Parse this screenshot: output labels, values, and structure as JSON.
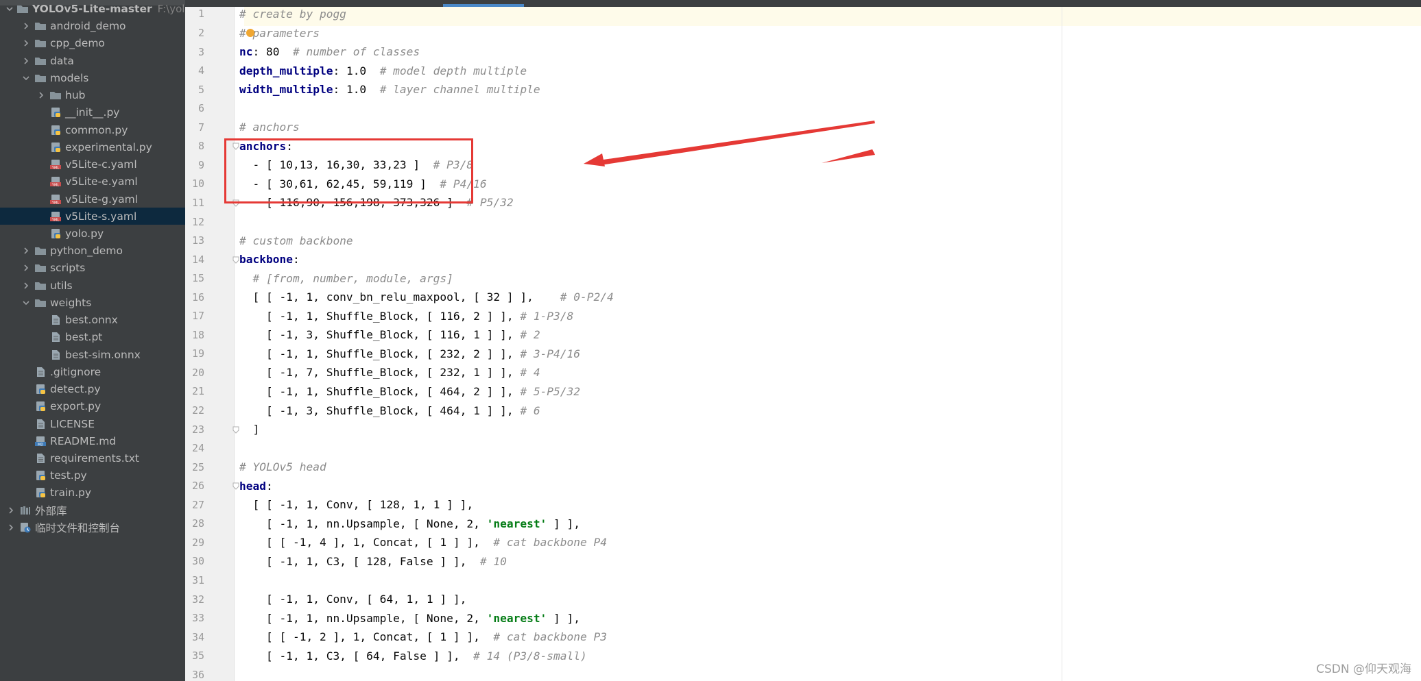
{
  "sidebar": {
    "project_name": "YOLOv5-Lite-master",
    "project_path_hint": "F:\\yolo\\",
    "tree": [
      {
        "label": "android_demo",
        "type": "folder",
        "expanded": false
      },
      {
        "label": "cpp_demo",
        "type": "folder",
        "expanded": false
      },
      {
        "label": "data",
        "type": "folder",
        "expanded": false
      },
      {
        "label": "models",
        "type": "folder",
        "expanded": true
      },
      {
        "label": "hub",
        "type": "folder",
        "expanded": false
      },
      {
        "label": "__init__.py",
        "type": "python"
      },
      {
        "label": "common.py",
        "type": "python"
      },
      {
        "label": "experimental.py",
        "type": "python"
      },
      {
        "label": "v5Lite-c.yaml",
        "type": "yaml"
      },
      {
        "label": "v5Lite-e.yaml",
        "type": "yaml"
      },
      {
        "label": "v5Lite-g.yaml",
        "type": "yaml"
      },
      {
        "label": "v5Lite-s.yaml",
        "type": "yaml",
        "selected": true
      },
      {
        "label": "yolo.py",
        "type": "python"
      },
      {
        "label": "python_demo",
        "type": "folder",
        "expanded": false
      },
      {
        "label": "scripts",
        "type": "folder",
        "expanded": false
      },
      {
        "label": "utils",
        "type": "folder",
        "expanded": false
      },
      {
        "label": "weights",
        "type": "folder",
        "expanded": true
      },
      {
        "label": "best.onnx",
        "type": "file"
      },
      {
        "label": "best.pt",
        "type": "file"
      },
      {
        "label": "best-sim.onnx",
        "type": "file"
      },
      {
        "label": ".gitignore",
        "type": "file"
      },
      {
        "label": "detect.py",
        "type": "python"
      },
      {
        "label": "export.py",
        "type": "python"
      },
      {
        "label": "LICENSE",
        "type": "file"
      },
      {
        "label": "README.md",
        "type": "markdown"
      },
      {
        "label": "requirements.txt",
        "type": "file"
      },
      {
        "label": "test.py",
        "type": "python"
      },
      {
        "label": "train.py",
        "type": "python"
      },
      {
        "label": "外部库",
        "type": "library",
        "expanded": false
      },
      {
        "label": "临时文件和控制台",
        "type": "scratch",
        "expanded": false
      }
    ]
  },
  "editor": {
    "lines": [
      "# create by pogg",
      "# parameters",
      "nc: 80  # number of classes",
      "depth_multiple: 1.0  # model depth multiple",
      "width_multiple: 1.0  # layer channel multiple",
      "",
      "# anchors",
      "anchors:",
      "  - [ 10,13, 16,30, 33,23 ]  # P3/8",
      "  - [ 30,61, 62,45, 59,119 ]  # P4/16",
      "  - [ 116,90, 156,198, 373,326 ]  # P5/32",
      "",
      "# custom backbone",
      "backbone:",
      "  # [from, number, module, args]",
      "  [ [ -1, 1, conv_bn_relu_maxpool, [ 32 ] ],    # 0-P2/4",
      "    [ -1, 1, Shuffle_Block, [ 116, 2 ] ], # 1-P3/8",
      "    [ -1, 3, Shuffle_Block, [ 116, 1 ] ], # 2",
      "    [ -1, 1, Shuffle_Block, [ 232, 2 ] ], # 3-P4/16",
      "    [ -1, 7, Shuffle_Block, [ 232, 1 ] ], # 4",
      "    [ -1, 1, Shuffle_Block, [ 464, 2 ] ], # 5-P5/32",
      "    [ -1, 3, Shuffle_Block, [ 464, 1 ] ], # 6",
      "  ]",
      "",
      "# YOLOv5 head",
      "head:",
      "  [ [ -1, 1, Conv, [ 128, 1, 1 ] ],",
      "    [ -1, 1, nn.Upsample, [ None, 2, 'nearest' ] ],",
      "    [ [ -1, 4 ], 1, Concat, [ 1 ] ],  # cat backbone P4",
      "    [ -1, 1, C3, [ 128, False ] ],  # 10",
      "",
      "    [ -1, 1, Conv, [ 64, 1, 1 ] ],",
      "    [ -1, 1, nn.Upsample, [ None, 2, 'nearest' ] ],",
      "    [ [ -1, 2 ], 1, Concat, [ 1 ] ],  # cat backbone P3",
      "    [ -1, 1, C3, [ 64, False ] ],  # 14 (P3/8-small)",
      ""
    ],
    "line_numbers": [
      "1",
      "2",
      "3",
      "4",
      "5",
      "6",
      "7",
      "8",
      "9",
      "10",
      "11",
      "12",
      "13",
      "14",
      "15",
      "16",
      "17",
      "18",
      "19",
      "20",
      "21",
      "22",
      "23",
      "24",
      "25",
      "26",
      "27",
      "28",
      "29",
      "30",
      "31",
      "32",
      "33",
      "34",
      "35",
      "36"
    ]
  },
  "colors": {
    "sidebar_bg": "#3c3f41",
    "selection_bg": "#0d293e",
    "keyword": "#000080",
    "comment": "#8c8c8c",
    "string": "#067d17",
    "annotation_red": "#e53935"
  },
  "watermark": "CSDN @仰天观海"
}
